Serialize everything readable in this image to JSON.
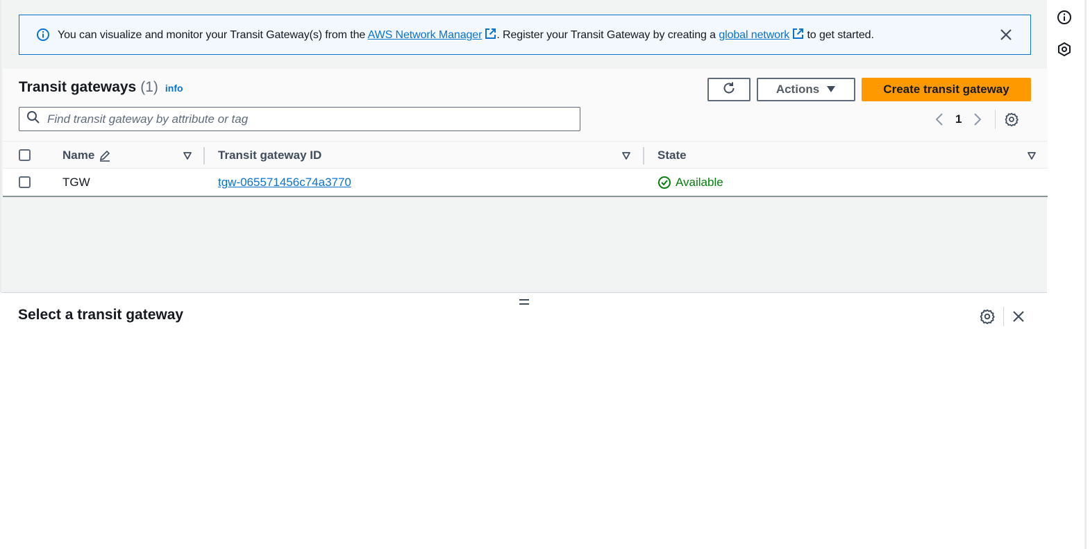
{
  "flash": {
    "text_before": "You can visualize and monitor your Transit Gateway(s) from the ",
    "link_network_manager": "AWS Network Manager",
    "text_middle": ". Register your Transit Gateway by creating a ",
    "link_global_network": "global network",
    "text_after": " to get started.",
    "info_icon": "info-icon",
    "close_icon": "close-icon"
  },
  "table_header": {
    "title": "Transit gateways",
    "count": "(1)",
    "info_link": "info"
  },
  "toolbar": {
    "refresh_icon": "refresh-icon",
    "actions_label": "Actions",
    "create_label": "Create transit gateway"
  },
  "search": {
    "placeholder": "Find transit gateway by attribute or tag",
    "value": ""
  },
  "pagination": {
    "current_page": "1"
  },
  "columns": [
    {
      "label": "Name"
    },
    {
      "label": "Transit gateway ID"
    },
    {
      "label": "State"
    }
  ],
  "rows": [
    {
      "name": "TGW",
      "id": "tgw-065571456c74a3770",
      "state": "Available"
    }
  ],
  "split_panel": {
    "title": "Select a transit gateway"
  },
  "colors": {
    "accent": "#0972d3",
    "primary_button": "#ff9900",
    "status_success": "#037f0c",
    "flash_bg": "#f2f8fd"
  }
}
